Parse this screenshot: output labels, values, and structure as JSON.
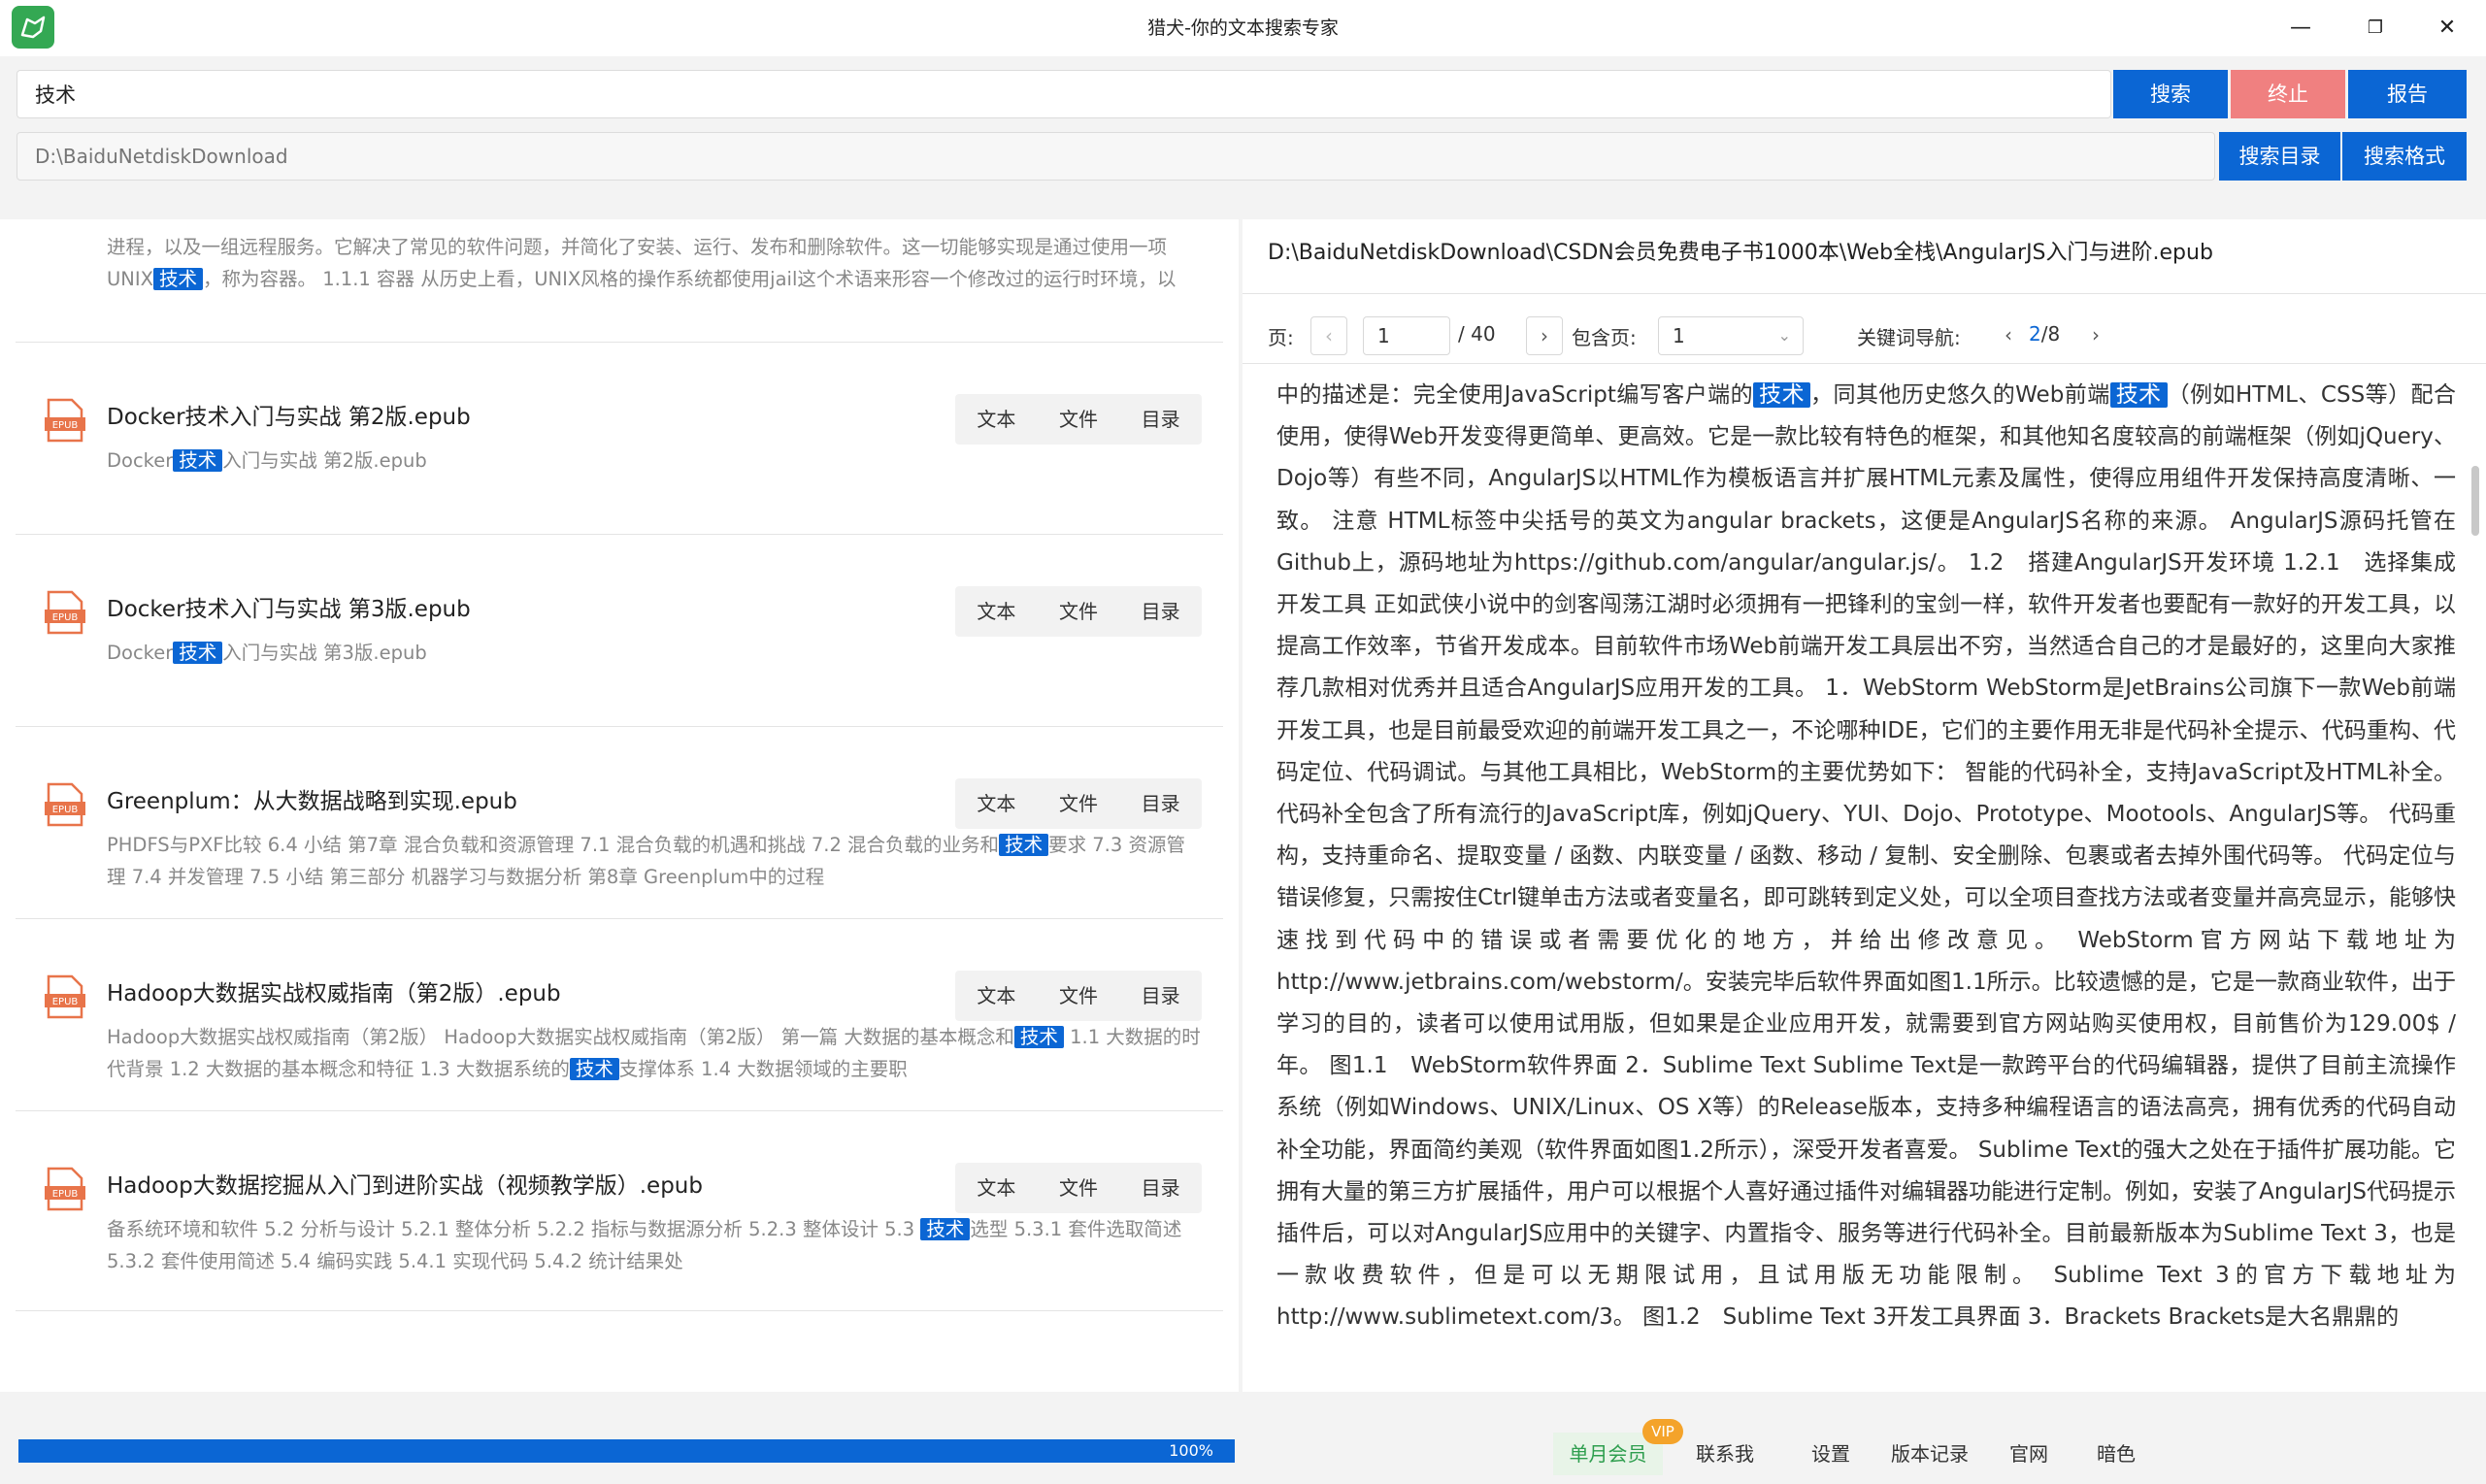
{
  "window": {
    "title": "猎犬-你的文本搜索专家",
    "minimize": "—",
    "maximize": "❐",
    "close": "✕"
  },
  "search": {
    "query": "技术",
    "directory_placeholder": "D:\\BaiduNetdiskDownload"
  },
  "buttons": {
    "search": "搜索",
    "stop": "终止",
    "report": "报告",
    "search_dir": "搜索目录",
    "search_format": "搜索格式"
  },
  "results": {
    "partial": {
      "p1": "进程，以及一组远程服务。它解决了常见的软件问题，并简化了安装、运行、发布和删除软件。这一切能够实现是通过使用一项UNIX",
      "hl": "技术",
      "p2": "，称为容器。 1.1.1 容器 从历史上看，UNIX风格的操作系统都使用jail这个术语来形容一个修改过的运行时环境，以"
    },
    "item_buttons": {
      "text": "文本",
      "file": "文件",
      "toc": "目录"
    },
    "epub_label": "EPUB",
    "items": [
      {
        "title": "Docker技术入门与实战 第2版.epub",
        "pre": "Docker",
        "hl": "技术",
        "post": "入门与实战 第2版.epub"
      },
      {
        "title": "Docker技术入门与实战 第3版.epub",
        "pre": "Docker",
        "hl": "技术",
        "post": "入门与实战 第3版.epub"
      },
      {
        "title": "Greenplum：从大数据战略到实现.epub",
        "pre": "PHDFS与PXF比较 6.4 小结 第7章 混合负载和资源管理 7.1 混合负载的机遇和挑战 7.2 混合负载的业务和",
        "hl": "技术",
        "post": "要求 7.3 资源管理 7.4 并发管理 7.5 小结 第三部分 机器学习与数据分析 第8章 Greenplum中的过程"
      },
      {
        "title": "Hadoop大数据实战权威指南（第2版）.epub",
        "pre": "Hadoop大数据实战权威指南（第2版） Hadoop大数据实战权威指南（第2版） 第一篇 大数据的基本概念和",
        "hl": "技术",
        "mid": " 1.1 大数据的时代背景 1.2 大数据的基本概念和特征 1.3 大数据系统的",
        "hl2": "技术",
        "post": "支撑体系 1.4 大数据领域的主要职"
      },
      {
        "title": "Hadoop大数据挖掘从入门到进阶实战（视频教学版）.epub",
        "pre": "备系统环境和软件 5.2 分析与设计 5.2.1 整体分析 5.2.2 指标与数据源分析 5.2.3 整体设计 5.3 ",
        "hl": "技术",
        "post": "选型 5.3.1 套件选取简述 5.3.2 套件使用简述 5.4 编码实践 5.4.1 实现代码 5.4.2 统计结果处"
      }
    ]
  },
  "viewer": {
    "path": "D:\\BaiduNetdiskDownload\\CSDN会员免费电子书1000本\\Web全栈\\AngularJS入门与进阶.epub",
    "page_label": "页:",
    "page_value": "1",
    "page_total": "/ 40",
    "contains_label": "包含页:",
    "contains_value": "1",
    "keyword_nav_label": "关键词导航:",
    "keyword_current": "2",
    "keyword_total": "/8",
    "text_a": "中的描述是：完全使用JavaScript编写客户端的",
    "hl_a": "技术",
    "text_b": "，同其他历史悠久的Web前端",
    "hl_b": "技术",
    "text_c": "（例如HTML、CSS等）配合使用，使得Web开发变得更简单、更高效。它是一款比较有特色的框架，和其他知名度较高的前端框架（例如jQuery、Dojo等）有些不同，AngularJS以HTML作为模板语言并扩展HTML元素及属性，使得应用组件开发保持高度清晰、一致。 注意 HTML标签中尖括号的英文为angular brackets，这便是AngularJS名称的来源。 AngularJS源码托管在Github上，源码地址为https://github.com/angular/angular.js/。 1.2　搭建AngularJS开发环境 1.2.1　选择集成开发工具 正如武侠小说中的剑客闯荡江湖时必须拥有一把锋利的宝剑一样，软件开发者也要配有一款好的开发工具，以提高工作效率，节省开发成本。目前软件市场Web前端开发工具层出不穷，当然适合自己的才是最好的，这里向大家推荐几款相对优秀并且适合AngularJS应用开发的工具。 1．WebStorm WebStorm是JetBrains公司旗下一款Web前端开发工具，也是目前最受欢迎的前端开发工具之一，不论哪种IDE，它们的主要作用无非是代码补全提示、代码重构、代码定位、代码调试。与其他工具相比，WebStorm的主要优势如下： 智能的代码补全，支持JavaScript及HTML补全。代码补全包含了所有流行的JavaScript库，例如jQuery、YUI、Dojo、Prototype、Mootools、AngularJS等。 代码重构，支持重命名、提取变量 / 函数、内联变量 / 函数、移动 / 复制、安全删除、包裹或者去掉外围代码等。 代码定位与错误修复，只需按住Ctrl键单击方法或者变量名，即可跳转到定义处，可以全项目查找方法或者变量并高亮显示，能够快速找到代码中的错误或者需要优化的地方，并给出修改意见。 WebStorm官方网站下载地址为http://www.jetbrains.com/webstorm/。安装完毕后软件界面如图1.1所示。比较遗憾的是，它是一款商业软件，出于学习的目的，读者可以使用试用版，但如果是企业应用开发，就需要到官方网站购买使用权，目前售价为129.00$ / 年。 图1.1　WebStorm软件界面 2．Sublime Text Sublime Text是一款跨平台的代码编辑器，提供了目前主流操作系统（例如Windows、UNIX/Linux、OS X等）的Release版本，支持多种编程语言的语法高亮，拥有优秀的代码自动补全功能，界面简约美观（软件界面如图1.2所示），深受开发者喜爱。 Sublime Text的强大之处在于插件扩展功能。它拥有大量的第三方扩展插件，用户可以根据个人喜好通过插件对编辑器功能进行定制。例如，安装了AngularJS代码提示插件后，可以对AngularJS应用中的关键字、内置指令、服务等进行代码补全。目前最新版本为Sublime Text 3，也是一款收费软件，但是可以无期限试用，且试用版无功能限制。 Sublime Text 3的官方下载地址为http://www.sublimetext.com/3。 图1.2　Sublime Text 3开发工具界面 3．Brackets Brackets是大名鼎鼎的"
  },
  "progress": {
    "value": 1.0,
    "label": "100%"
  },
  "footer": {
    "vip_label": "单月会员",
    "vip_badge": "VIP",
    "contact": "联系我",
    "settings": "设置",
    "changelog": "版本记录",
    "website": "官网",
    "dark": "暗色"
  },
  "colors": {
    "accent": "#0b66d4",
    "stop": "#f08080",
    "epub": "#e8744a",
    "app_icon": "#34a853",
    "vip": "#f4a32a"
  },
  "icons": {
    "app": "hound-icon",
    "epub": "epub-file-icon",
    "prev": "chevron-left-icon",
    "next": "chevron-right-icon",
    "dropdown": "chevron-down-icon"
  }
}
